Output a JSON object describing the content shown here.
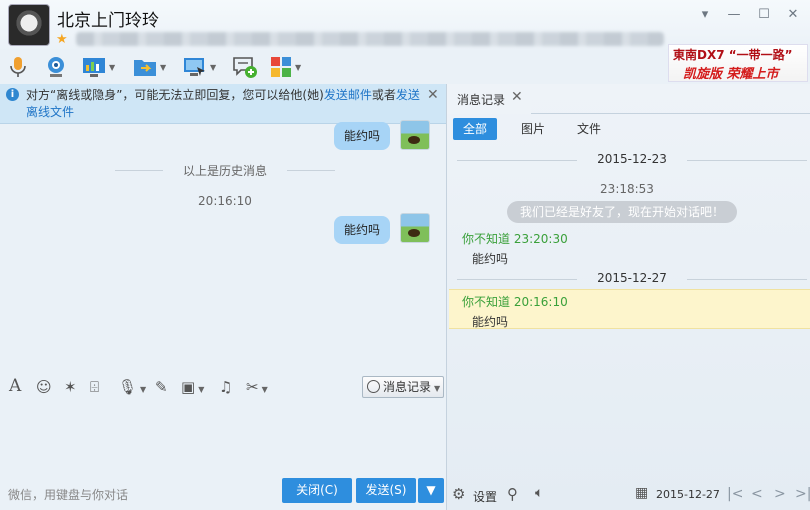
{
  "header": {
    "contact_name": "北京上门玲玲",
    "window_controls": [
      "chevron-down-icon",
      "minimize-icon",
      "maximize-icon",
      "close-icon"
    ]
  },
  "ad": {
    "line1": "東南DX7 “一带一路”",
    "line2": "凯旋版 荣耀上市"
  },
  "toolbar": {
    "icons": [
      "microphone-icon",
      "video-camera-icon",
      "share-screen-icon",
      "send-file-icon",
      "remote-desktop-icon",
      "add-message-icon",
      "apps-icon"
    ]
  },
  "banner": {
    "text_prefix": "对方“离线或隐身”，可能无法立即回复，您可以给他(她)",
    "link_mail": "发送邮件",
    "text_mid": "或者",
    "link_file": "发送离线文件"
  },
  "chat": {
    "messages": [
      {
        "text": "能约吗"
      },
      {
        "text": "能约吗"
      }
    ],
    "history_label": "以上是历史消息",
    "time": "20:16:10"
  },
  "editor": {
    "tools": [
      "font-icon",
      "emoji-icon",
      "magic-wand-icon",
      "shake-icon",
      "voice-icon",
      "edit-icon",
      "image-icon",
      "music-icon",
      "scissors-icon"
    ],
    "history_button": "消息记录",
    "hint": "微信，用键盘与你对话",
    "close_button": "关闭(C)",
    "send_button": "发送(S)"
  },
  "history_panel": {
    "tab_label": "消息记录",
    "filters": [
      "全部",
      "图片",
      "文件"
    ],
    "date1": "2015-12-23",
    "sys_time": "23:18:53",
    "sys_msg": "我们已经是好友了，现在开始对话吧！",
    "entry1": {
      "sender": "你不知道 23:20:30",
      "text": "能约吗"
    },
    "date2": "2015-12-27",
    "entry2": {
      "sender": "你不知道 20:16:10",
      "text": "能约吗"
    },
    "settings_label": "设置",
    "current_date": "2015-12-27"
  },
  "colors": {
    "accent": "#2e8ede",
    "bubble": "#a7d4f6",
    "sender": "#3aa03a",
    "highlight": "#fdf5cc"
  }
}
